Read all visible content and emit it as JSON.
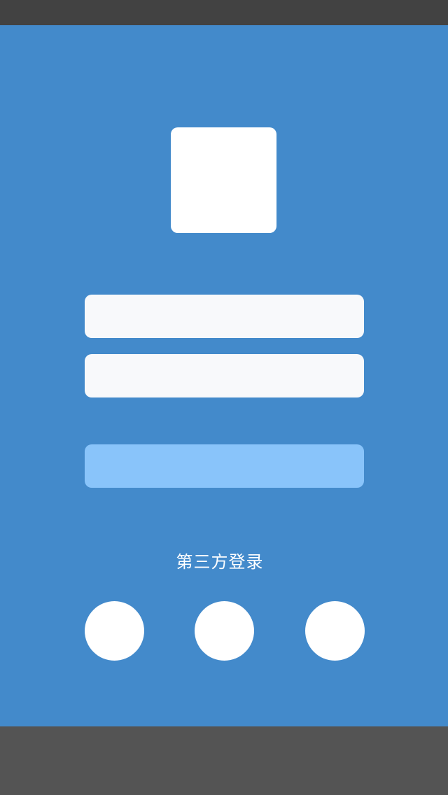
{
  "login": {
    "username_placeholder": "",
    "password_placeholder": "",
    "submit_label": ""
  },
  "third_party": {
    "label": "第三方登录",
    "providers": [
      "",
      "",
      ""
    ]
  },
  "colors": {
    "status_bar": "#424242",
    "background": "#438ACB",
    "field": "#F8F9FB",
    "button": "#89C4FA",
    "bottom_bar": "#545454"
  }
}
